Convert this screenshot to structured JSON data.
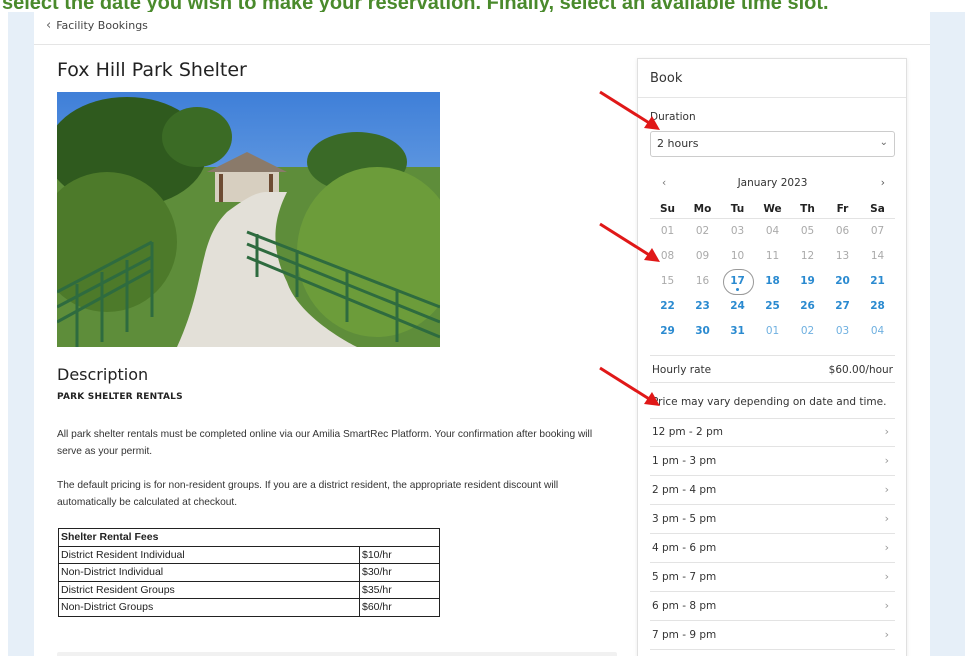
{
  "banner_text": "select the date you wish to make your reservation. Finally, select an available time slot.",
  "breadcrumb": {
    "icon": "chevron-left-icon",
    "label": "Facility Bookings"
  },
  "facility": {
    "title": "Fox Hill Park Shelter",
    "description_heading": "Description",
    "description_subheading": "PARK SHELTER RENTALS",
    "paragraph1": "All park shelter rentals must be completed online via our Amilia SmartRec Platform. Your confirmation after booking will serve as your permit.",
    "paragraph2": "The default pricing is for non-resident groups. If you are a district resident, the appropriate resident discount will automatically be calculated at checkout."
  },
  "fees_table": {
    "header": "Shelter Rental Fees",
    "rows": [
      {
        "label": "District Resident Individual",
        "price": "$10/hr"
      },
      {
        "label": "Non-District Individual",
        "price": "$30/hr"
      },
      {
        "label": "District Resident Groups",
        "price": "$35/hr"
      },
      {
        "label": "Non-District Groups",
        "price": "$60/hr"
      }
    ]
  },
  "booking": {
    "title": "Book",
    "duration_label": "Duration",
    "duration_value": "2 hours",
    "calendar": {
      "month_label": "January 2023",
      "prev_icon": "chevron-left-icon",
      "next_icon": "chevron-right-icon",
      "weekdays": [
        "Su",
        "Mo",
        "Tu",
        "We",
        "Th",
        "Fr",
        "Sa"
      ],
      "weeks": [
        [
          {
            "d": "01",
            "s": "past"
          },
          {
            "d": "02",
            "s": "past"
          },
          {
            "d": "03",
            "s": "past"
          },
          {
            "d": "04",
            "s": "past"
          },
          {
            "d": "05",
            "s": "past"
          },
          {
            "d": "06",
            "s": "past"
          },
          {
            "d": "07",
            "s": "past"
          }
        ],
        [
          {
            "d": "08",
            "s": "past"
          },
          {
            "d": "09",
            "s": "past"
          },
          {
            "d": "10",
            "s": "past"
          },
          {
            "d": "11",
            "s": "past"
          },
          {
            "d": "12",
            "s": "past"
          },
          {
            "d": "13",
            "s": "past"
          },
          {
            "d": "14",
            "s": "past"
          }
        ],
        [
          {
            "d": "15",
            "s": "past"
          },
          {
            "d": "16",
            "s": "past"
          },
          {
            "d": "17",
            "s": "today"
          },
          {
            "d": "18",
            "s": "avail"
          },
          {
            "d": "19",
            "s": "avail"
          },
          {
            "d": "20",
            "s": "avail"
          },
          {
            "d": "21",
            "s": "avail"
          }
        ],
        [
          {
            "d": "22",
            "s": "avail"
          },
          {
            "d": "23",
            "s": "avail"
          },
          {
            "d": "24",
            "s": "avail"
          },
          {
            "d": "25",
            "s": "avail"
          },
          {
            "d": "26",
            "s": "avail"
          },
          {
            "d": "27",
            "s": "avail"
          },
          {
            "d": "28",
            "s": "avail"
          }
        ],
        [
          {
            "d": "29",
            "s": "avail"
          },
          {
            "d": "30",
            "s": "avail"
          },
          {
            "d": "31",
            "s": "avail"
          },
          {
            "d": "01",
            "s": "next"
          },
          {
            "d": "02",
            "s": "next"
          },
          {
            "d": "03",
            "s": "next"
          },
          {
            "d": "04",
            "s": "next"
          }
        ]
      ]
    },
    "hourly_rate_label": "Hourly rate",
    "hourly_rate_value": "$60.00/hour",
    "price_note": "Price may vary depending on date and time.",
    "time_slots": [
      "12 pm - 2 pm",
      "1 pm - 3 pm",
      "2 pm - 4 pm",
      "3 pm - 5 pm",
      "4 pm - 6 pm",
      "5 pm - 7 pm",
      "6 pm - 8 pm",
      "7 pm - 9 pm"
    ]
  },
  "colors": {
    "banner": "#4a8a2c",
    "side_panel": "#e6eff8",
    "available_date": "#2a8ad0",
    "annotation_arrow": "#e01818"
  }
}
